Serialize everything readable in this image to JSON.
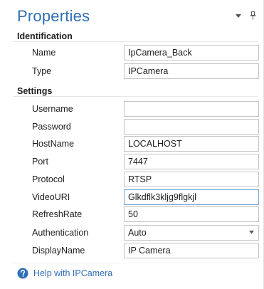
{
  "panel": {
    "title": "Properties"
  },
  "sections": {
    "identification": {
      "header": "Identification",
      "rows": [
        {
          "label": "Name",
          "value": "IpCamera_Back"
        },
        {
          "label": "Type",
          "value": "IPCamera"
        }
      ]
    },
    "settings": {
      "header": "Settings",
      "rows": [
        {
          "label": "Username",
          "value": ""
        },
        {
          "label": "Password",
          "value": ""
        },
        {
          "label": "HostName",
          "value": "LOCALHOST"
        },
        {
          "label": "Port",
          "value": "7447"
        },
        {
          "label": "Protocol",
          "value": "RTSP"
        },
        {
          "label": "VideoURI",
          "value": "Glkdflk3kljg9flgkjl"
        },
        {
          "label": "RefreshRate",
          "value": "50"
        },
        {
          "label": "Authentication",
          "value": "Auto"
        },
        {
          "label": "DisplayName",
          "value": "IP Camera"
        }
      ]
    }
  },
  "help": {
    "label": "Help with IPCamera"
  },
  "icons": {
    "dropdown": "chevron-down-icon",
    "pin": "pin-icon",
    "help": "help-circle-icon"
  },
  "colors": {
    "accent": "#2f6fb6",
    "border": "#c4c4c4",
    "active_border": "#7aa7d6"
  }
}
